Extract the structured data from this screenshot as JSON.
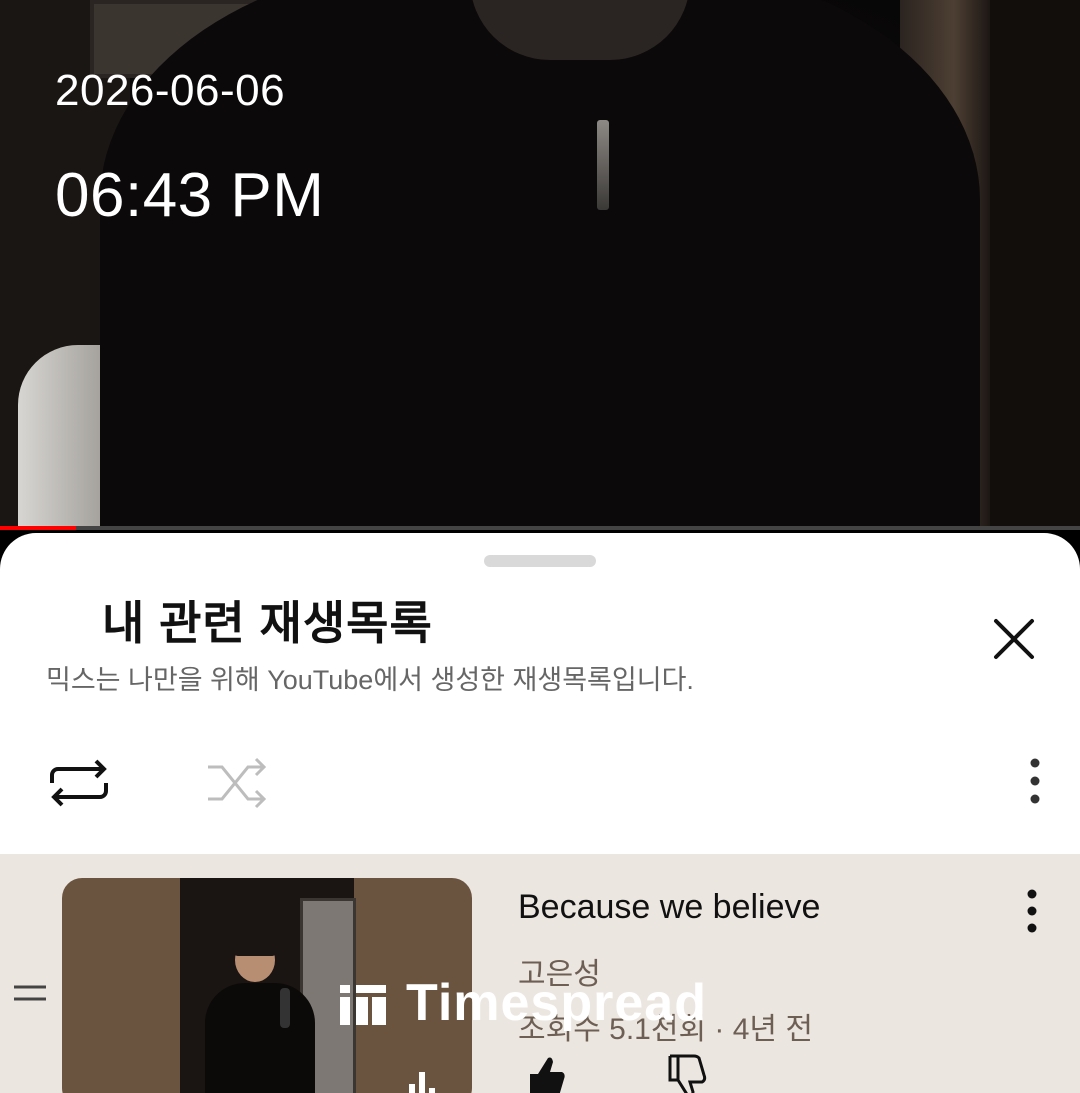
{
  "overlay": {
    "date": "2026-06-06",
    "time": "06:43 PM"
  },
  "video": {
    "progress_fraction": 0.07
  },
  "sheet": {
    "title": "내 관련 재생목록",
    "subtitle": "믹스는 나만을 위해 YouTube에서 생성한 재생목록입니다.",
    "controls": {
      "repeat_icon": "repeat-icon",
      "shuffle_icon": "shuffle-icon",
      "more_icon": "more-vert-icon",
      "close_icon": "close-icon"
    }
  },
  "playlist": {
    "items": [
      {
        "title": "Because we believe",
        "artist": "고은성",
        "meta": "조회수 5.1천회 · 4년 전",
        "now_playing": true
      }
    ]
  },
  "watermark": {
    "text": "Timespread"
  },
  "colors": {
    "row_bg": "#ece6e0",
    "accent_red": "#ff0000"
  }
}
